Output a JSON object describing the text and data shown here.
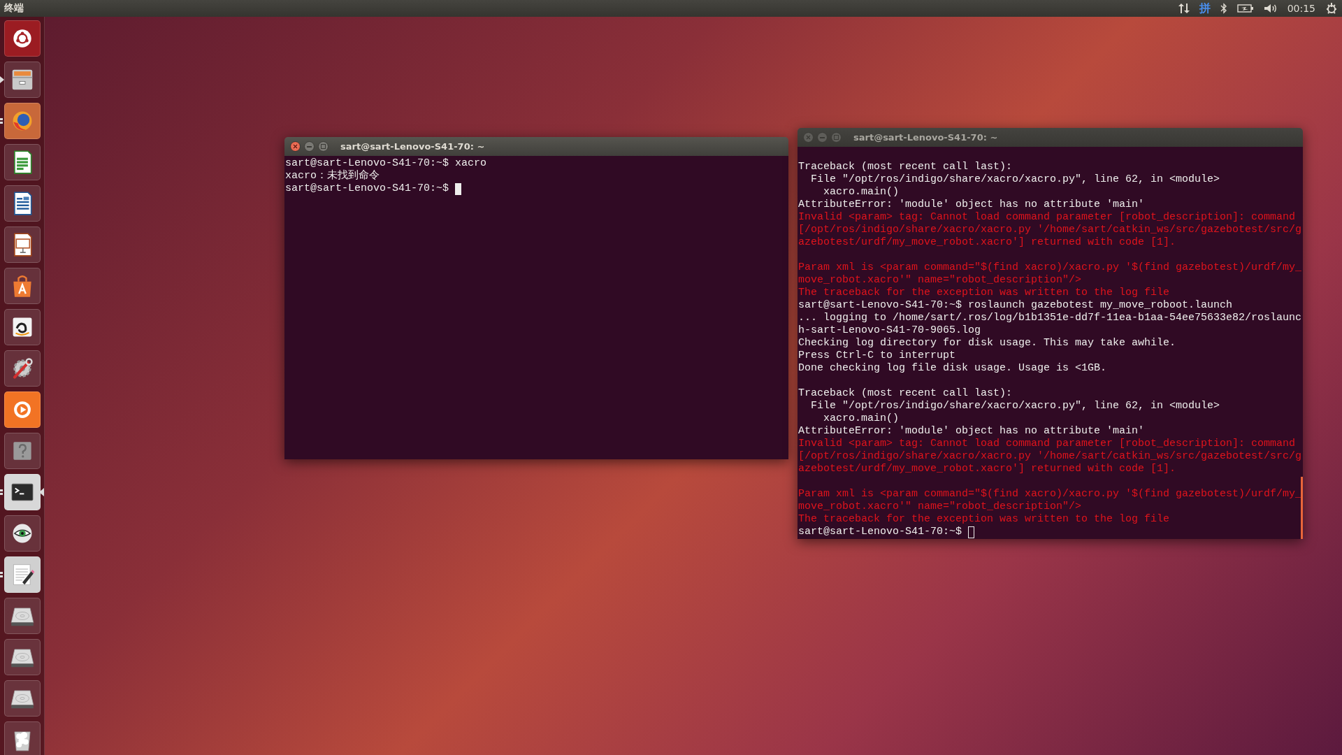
{
  "top_bar": {
    "app_title": "终端",
    "indicators": [
      {
        "kind": "network"
      },
      {
        "kind": "input_method",
        "label": "拼"
      },
      {
        "kind": "bluetooth"
      },
      {
        "kind": "battery"
      },
      {
        "kind": "volume"
      },
      {
        "kind": "clock",
        "label": "00:15"
      },
      {
        "kind": "system"
      }
    ]
  },
  "launcher": {
    "items": [
      {
        "kind": "ubuntu",
        "running": false,
        "focused": false
      },
      {
        "kind": "files",
        "running": true,
        "multiple_windows": false,
        "focused": false
      },
      {
        "kind": "browser",
        "running": true,
        "multiple_windows": true,
        "focused": false
      },
      {
        "kind": "spreadsheet",
        "running": false,
        "focused": false
      },
      {
        "kind": "document",
        "running": false,
        "focused": false
      },
      {
        "kind": "presentation",
        "running": false,
        "focused": false
      },
      {
        "kind": "software",
        "running": false,
        "focused": false
      },
      {
        "kind": "shop",
        "running": false,
        "focused": false
      },
      {
        "kind": "settings",
        "running": false,
        "focused": false
      },
      {
        "kind": "video",
        "running": false,
        "focused": false
      },
      {
        "kind": "help",
        "running": false,
        "focused": false
      },
      {
        "kind": "terminal",
        "running": true,
        "multiple_windows": true,
        "focused": true
      },
      {
        "kind": "eye",
        "running": false,
        "focused": false
      },
      {
        "kind": "editor",
        "running": true,
        "multiple_windows": true,
        "focused": false
      },
      {
        "kind": "drive",
        "running": false,
        "focused": false
      },
      {
        "kind": "drive",
        "running": false,
        "focused": false
      },
      {
        "kind": "drive",
        "running": false,
        "focused": false
      },
      {
        "kind": "trash",
        "running": false,
        "focused": false
      }
    ]
  },
  "windows": [
    {
      "title": "sart@sart-Lenovo-S41-70: ~",
      "active": true,
      "lines": [
        {
          "kind": "out",
          "text": "sart@sart-Lenovo-S41-70:~$ xacro"
        },
        {
          "kind": "out",
          "text": "xacro：未找到命令"
        },
        {
          "kind": "out",
          "text": "sart@sart-Lenovo-S41-70:~$"
        }
      ]
    },
    {
      "title": "sart@sart-Lenovo-S41-70: ~",
      "active": false,
      "lines": [
        {
          "kind": "blank"
        },
        {
          "kind": "out",
          "text": "Traceback (most recent call last):"
        },
        {
          "kind": "out",
          "text": "  File \"/opt/ros/indigo/share/xacro/xacro.py\", line 62, in <module>"
        },
        {
          "kind": "out",
          "text": "    xacro.main()"
        },
        {
          "kind": "out",
          "text": "AttributeError: 'module' object has no attribute 'main'"
        },
        {
          "kind": "err",
          "text": "Invalid <param> tag: Cannot load command parameter [robot_description]: command"
        },
        {
          "kind": "err",
          "text": "[/opt/ros/indigo/share/xacro/xacro.py '/home/sart/catkin_ws/src/gazebotest/src/g"
        },
        {
          "kind": "err",
          "text": "azebotest/urdf/my_move_robot.xacro'] returned with code [1]."
        },
        {
          "kind": "blank"
        },
        {
          "kind": "err",
          "text": "Param xml is <param command=\"$(find xacro)/xacro.py '$(find gazebotest)/urdf/my_"
        },
        {
          "kind": "err",
          "text": "move_robot.xacro'\" name=\"robot_description\"/>"
        },
        {
          "kind": "err",
          "text": "The traceback for the exception was written to the log file"
        },
        {
          "kind": "out",
          "text": "sart@sart-Lenovo-S41-70:~$ roslaunch gazebotest my_move_roboot.launch"
        },
        {
          "kind": "out",
          "text": "... logging to /home/sart/.ros/log/b1b1351e-dd7f-11ea-b1aa-54ee75633e82/roslaunc"
        },
        {
          "kind": "out",
          "text": "h-sart-Lenovo-S41-70-9065.log"
        },
        {
          "kind": "out",
          "text": "Checking log directory for disk usage. This may take awhile."
        },
        {
          "kind": "out",
          "text": "Press Ctrl-C to interrupt"
        },
        {
          "kind": "out",
          "text": "Done checking log file disk usage. Usage is <1GB."
        },
        {
          "kind": "blank"
        },
        {
          "kind": "out",
          "text": "Traceback (most recent call last):"
        },
        {
          "kind": "out",
          "text": "  File \"/opt/ros/indigo/share/xacro/xacro.py\", line 62, in <module>"
        },
        {
          "kind": "out",
          "text": "    xacro.main()"
        },
        {
          "kind": "out",
          "text": "AttributeError: 'module' object has no attribute 'main'"
        },
        {
          "kind": "err",
          "text": "Invalid <param> tag: Cannot load command parameter [robot_description]: command"
        },
        {
          "kind": "err",
          "text": "[/opt/ros/indigo/share/xacro/xacro.py '/home/sart/catkin_ws/src/gazebotest/src/g"
        },
        {
          "kind": "err",
          "text": "azebotest/urdf/my_move_robot.xacro'] returned with code [1]."
        },
        {
          "kind": "blank"
        },
        {
          "kind": "err",
          "text": "Param xml is <param command=\"$(find xacro)/xacro.py '$(find gazebotest)/urdf/my_"
        },
        {
          "kind": "err",
          "text": "move_robot.xacro'\" name=\"robot_description\"/>"
        },
        {
          "kind": "err",
          "text": "The traceback for the exception was written to the log file"
        },
        {
          "kind": "out",
          "text": "sart@sart-Lenovo-S41-70:~$"
        }
      ]
    }
  ]
}
